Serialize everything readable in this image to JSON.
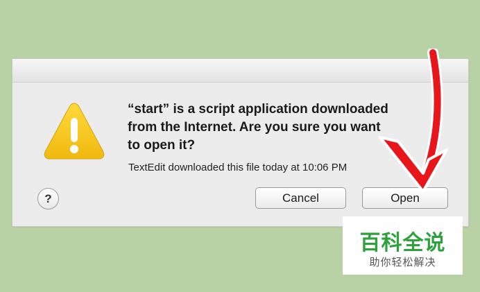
{
  "dialog": {
    "headline": "“start” is a script application downloaded\nfrom the Internet. Are you sure you want\nto open it?",
    "detail": "TextEdit downloaded this file today at 10:06 PM",
    "help_label": "?",
    "cancel_label": "Cancel",
    "open_label": "Open",
    "icon": "warning-icon"
  },
  "annotation": {
    "icon": "red-arrow-icon",
    "color": "#e8151b"
  },
  "watermark": {
    "title": "百科全说",
    "subtitle": "助你轻松解决"
  },
  "colors": {
    "background": "#b9d2a5",
    "warning": "#f2c21b",
    "watermark_green": "#2da23c"
  }
}
